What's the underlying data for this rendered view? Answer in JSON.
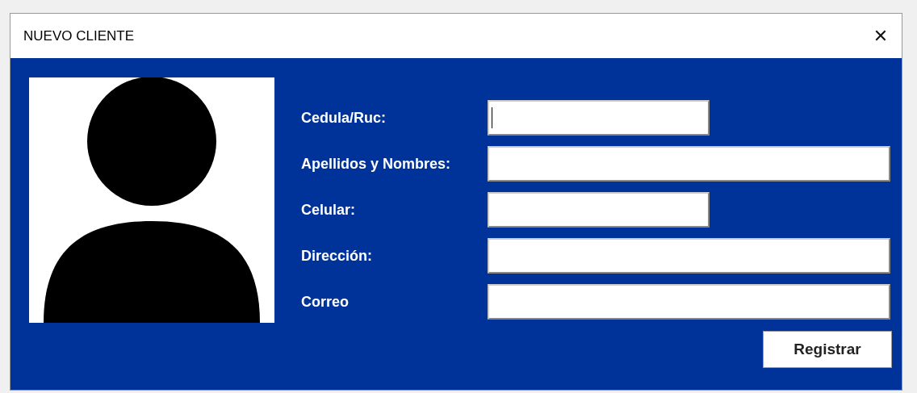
{
  "window": {
    "title": "NUEVO CLIENTE",
    "close": "✕"
  },
  "fields": [
    {
      "label": "Cedula/Ruc:",
      "kind": "short",
      "focused": true
    },
    {
      "label": "Apellidos y Nombres:",
      "kind": "wide",
      "focused": false
    },
    {
      "label": "Celular:",
      "kind": "short",
      "focused": false
    },
    {
      "label": "Dirección:",
      "kind": "wide",
      "focused": false
    },
    {
      "label": "Correo",
      "kind": "wide",
      "focused": false
    }
  ],
  "button": "Registrar"
}
